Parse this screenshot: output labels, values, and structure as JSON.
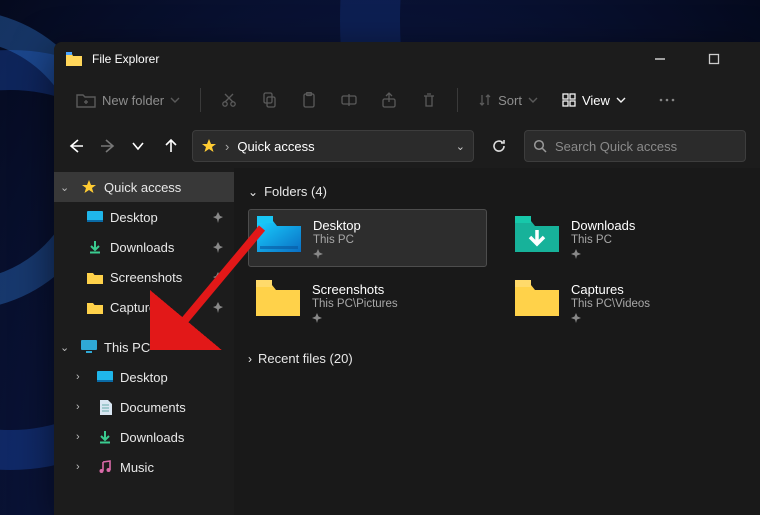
{
  "app": {
    "title": "File Explorer"
  },
  "toolbar": {
    "new_label": "New folder",
    "sort_label": "Sort",
    "view_label": "View"
  },
  "address": {
    "path": "Quick access"
  },
  "search": {
    "placeholder": "Search Quick access"
  },
  "sidebar": {
    "quick_access": {
      "label": "Quick access",
      "items": [
        {
          "label": "Desktop"
        },
        {
          "label": "Downloads"
        },
        {
          "label": "Screenshots"
        },
        {
          "label": "Captures"
        }
      ]
    },
    "this_pc": {
      "label": "This PC",
      "items": [
        {
          "label": "Desktop"
        },
        {
          "label": "Documents"
        },
        {
          "label": "Downloads"
        },
        {
          "label": "Music"
        }
      ]
    }
  },
  "content": {
    "folders_header": "Folders (4)",
    "recent_header": "Recent files (20)",
    "folders": [
      {
        "name": "Desktop",
        "location": "This PC",
        "selected": true,
        "icon": "desktop"
      },
      {
        "name": "Downloads",
        "location": "This PC",
        "selected": false,
        "icon": "downloads-green"
      },
      {
        "name": "Screenshots",
        "location": "This PC\\Pictures",
        "selected": false,
        "icon": "folder"
      },
      {
        "name": "Captures",
        "location": "This PC\\Videos",
        "selected": false,
        "icon": "folder"
      }
    ]
  }
}
